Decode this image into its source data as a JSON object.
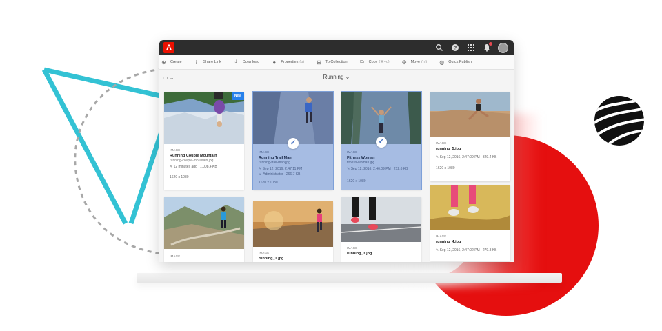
{
  "app": {
    "logo_letter": "A",
    "colors": {
      "brand_red": "#eb1000",
      "accent_blue": "#2680eb",
      "selected_bg": "#a6bce3",
      "titlebar": "#2d2d2d"
    }
  },
  "topbar": {
    "icons": [
      "search-icon",
      "help-icon",
      "apps-grid-icon",
      "notification-bell-icon",
      "user-avatar"
    ]
  },
  "actions": [
    {
      "icon": "create-icon",
      "label": "Create",
      "shortcut": ""
    },
    {
      "icon": "share-link-icon",
      "label": "Share Link",
      "shortcut": ""
    },
    {
      "icon": "download-icon",
      "label": "Download",
      "shortcut": ""
    },
    {
      "icon": "info-icon",
      "label": "Properties",
      "shortcut": "(p)"
    },
    {
      "icon": "collection-icon",
      "label": "To Collection",
      "shortcut": ""
    },
    {
      "icon": "copy-icon",
      "label": "Copy",
      "shortcut": "(⌘+c)"
    },
    {
      "icon": "move-icon",
      "label": "Move",
      "shortcut": "(m)"
    },
    {
      "icon": "globe-icon",
      "label": "Quick Publish",
      "shortcut": ""
    }
  ],
  "subbar": {
    "collection_title": "Running",
    "view_icon": "view-toggle-icon"
  },
  "cards": [
    {
      "type": "IMAGE",
      "title": "Running Couple Mountain",
      "file": "running-couple-mountain.jpg",
      "modified": "12 minutes ago",
      "size": "1,008.4 KB",
      "user": "",
      "dims": "1620 x 1080",
      "badge": "New",
      "selected": false
    },
    {
      "type": "IMAGE",
      "title": "Running Trail Man",
      "file": "running-trail-man.jpg",
      "modified": "Sep 12, 2016, 2:47:11 PM",
      "size": "",
      "user": "Administrator",
      "user_size": "266.7 KB",
      "dims": "1620 x 1080",
      "badge": "",
      "selected": true
    },
    {
      "type": "IMAGE",
      "title": "Fitness Woman",
      "file": "fitness-woman.jpg",
      "modified": "Sep 12, 2016, 2:46:09 PM",
      "size": "212.6 KB",
      "user": "",
      "dims": "1620 x 1080",
      "badge": "",
      "selected": true
    },
    {
      "type": "IMAGE",
      "title": "running_5.jpg",
      "file": "",
      "modified": "Sep 12, 2016, 2:47:09 PM",
      "size": "329.4 KB",
      "user": "",
      "dims": "1620 x 1080",
      "badge": "",
      "selected": false
    },
    {
      "type": "IMAGE",
      "title": "",
      "file": "",
      "modified": "",
      "size": "",
      "user": "",
      "dims": "",
      "badge": "",
      "selected": false
    },
    {
      "type": "IMAGE",
      "title": "running_1.jpg",
      "file": "",
      "modified": "",
      "size": "",
      "user": "",
      "dims": "",
      "badge": "",
      "selected": false
    },
    {
      "type": "IMAGE",
      "title": "running_3.jpg",
      "file": "",
      "modified": "",
      "size": "",
      "user": "",
      "dims": "",
      "badge": "",
      "selected": false
    },
    {
      "type": "IMAGE",
      "title": "running_4.jpg",
      "file": "",
      "modified": "Sep 12, 2016, 2:47:02 PM",
      "size": "279.3 KB",
      "user": "",
      "dims": "",
      "badge": "",
      "selected": false
    }
  ]
}
